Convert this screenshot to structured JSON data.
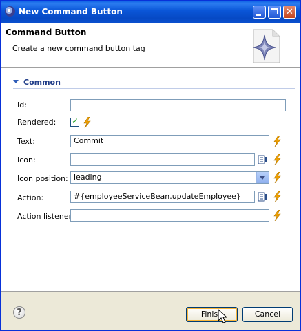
{
  "window": {
    "title": "New Command Button",
    "title_icon": "eclipse-icon"
  },
  "header": {
    "title": "Command Button",
    "description": "Create a new command button tag",
    "graphic_icon": "wizard-star-icon"
  },
  "section": {
    "title": "Common",
    "toggle_icon": "triangle-down-icon"
  },
  "form": {
    "id": {
      "label": "Id:",
      "value": ""
    },
    "rendered": {
      "label": "Rendered:",
      "checked": true
    },
    "text": {
      "label": "Text:",
      "value": "Commit"
    },
    "icon": {
      "label": "Icon:",
      "value": ""
    },
    "icon_position": {
      "label": "Icon position:",
      "value": "leading"
    },
    "action": {
      "label": "Action:",
      "value": "#{employeeServiceBean.updateEmployee}"
    },
    "action_listener": {
      "label": "Action listener:",
      "value": ""
    }
  },
  "buttons": {
    "finish": "Finish",
    "cancel": "Cancel"
  },
  "colors": {
    "titlebar": "#0a56d8",
    "dialog_bg": "#ece9d8",
    "section_title": "#1f3c88",
    "bolt": "#f2a200"
  }
}
